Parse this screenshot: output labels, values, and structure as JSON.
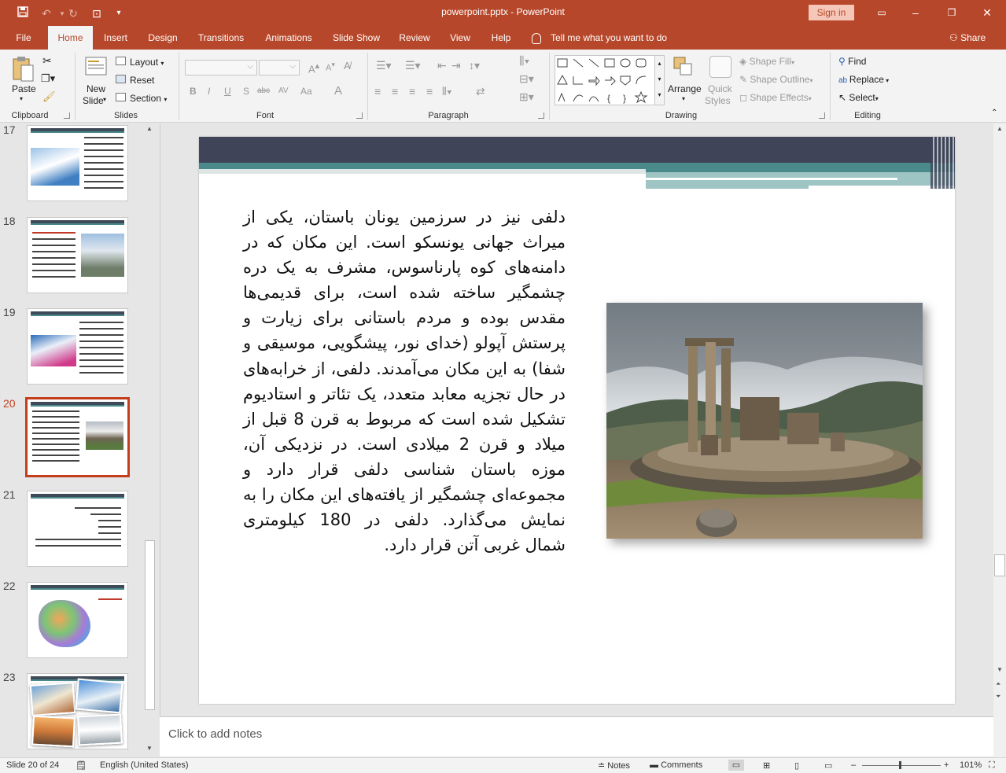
{
  "window": {
    "title": "powerpoint.pptx  -  PowerPoint",
    "signin": "Sign in"
  },
  "tabs": [
    "File",
    "Home",
    "Insert",
    "Design",
    "Transitions",
    "Animations",
    "Slide Show",
    "Review",
    "View",
    "Help"
  ],
  "tellme": "Tell me what you want to do",
  "share": "Share",
  "ribbon": {
    "clipboard": {
      "paste": "Paste",
      "label": "Clipboard"
    },
    "slides": {
      "new_slide": "New",
      "new_slide2": "Slide",
      "layout": "Layout",
      "reset": "Reset",
      "section": "Section",
      "label": "Slides"
    },
    "font": {
      "label": "Font",
      "bold": "B",
      "italic": "I",
      "underline": "U",
      "shadow": "S",
      "strike": "abc",
      "spacing": "AV",
      "case": "Aa",
      "color": "A"
    },
    "paragraph": {
      "label": "Paragraph"
    },
    "drawing": {
      "arrange": "Arrange",
      "quick_styles": "Quick",
      "quick_styles2": "Styles",
      "shape_fill": "Shape Fill",
      "shape_outline": "Shape Outline",
      "shape_effects": "Shape Effects",
      "label": "Drawing"
    },
    "editing": {
      "find": "Find",
      "replace": "Replace",
      "select": "Select",
      "label": "Editing"
    }
  },
  "thumbnails": [
    {
      "num": "17"
    },
    {
      "num": "18"
    },
    {
      "num": "19"
    },
    {
      "num": "20"
    },
    {
      "num": "21"
    },
    {
      "num": "22"
    },
    {
      "num": "23"
    }
  ],
  "slide": {
    "text": "دلفی نیز در سرزمین یونان باستان، یکی از میراث جهانی یونسکو است. این مکان که در دامنه‌های کوه پارناسوس، مشرف به یک دره چشمگیر ساخته شده است، برای قدیمی‌ها مقدس بوده و مردم باستانی برای زیارت و پرستش آپولو (خدای نور، پیشگویی، موسیقی و شفا) به این مکان می‌آمدند. دلفی، از خرابه‌های در حال تجزیه معابد متعدد، یک تئاتر و استادیوم تشکیل شده است که مربوط به قرن 8 قبل از میلاد و قرن 2 میلادی است. در نزدیکی آن، موزه باستان شناسی دلفی قرار دارد و مجموعه‌ای چشمگیر از یافته‌های این مکان را به نمایش می‌گذارد. دلفی در 180 کیلومتری شمال غربی آتن قرار دارد."
  },
  "notes": {
    "placeholder": "Click to add notes"
  },
  "status": {
    "slide": "Slide 20 of 24",
    "language": "English (United States)",
    "notes": "Notes",
    "comments": "Comments",
    "zoom": "101%"
  },
  "colors": {
    "accent": "#b7472a",
    "active_thumb": "#c43e1c"
  }
}
